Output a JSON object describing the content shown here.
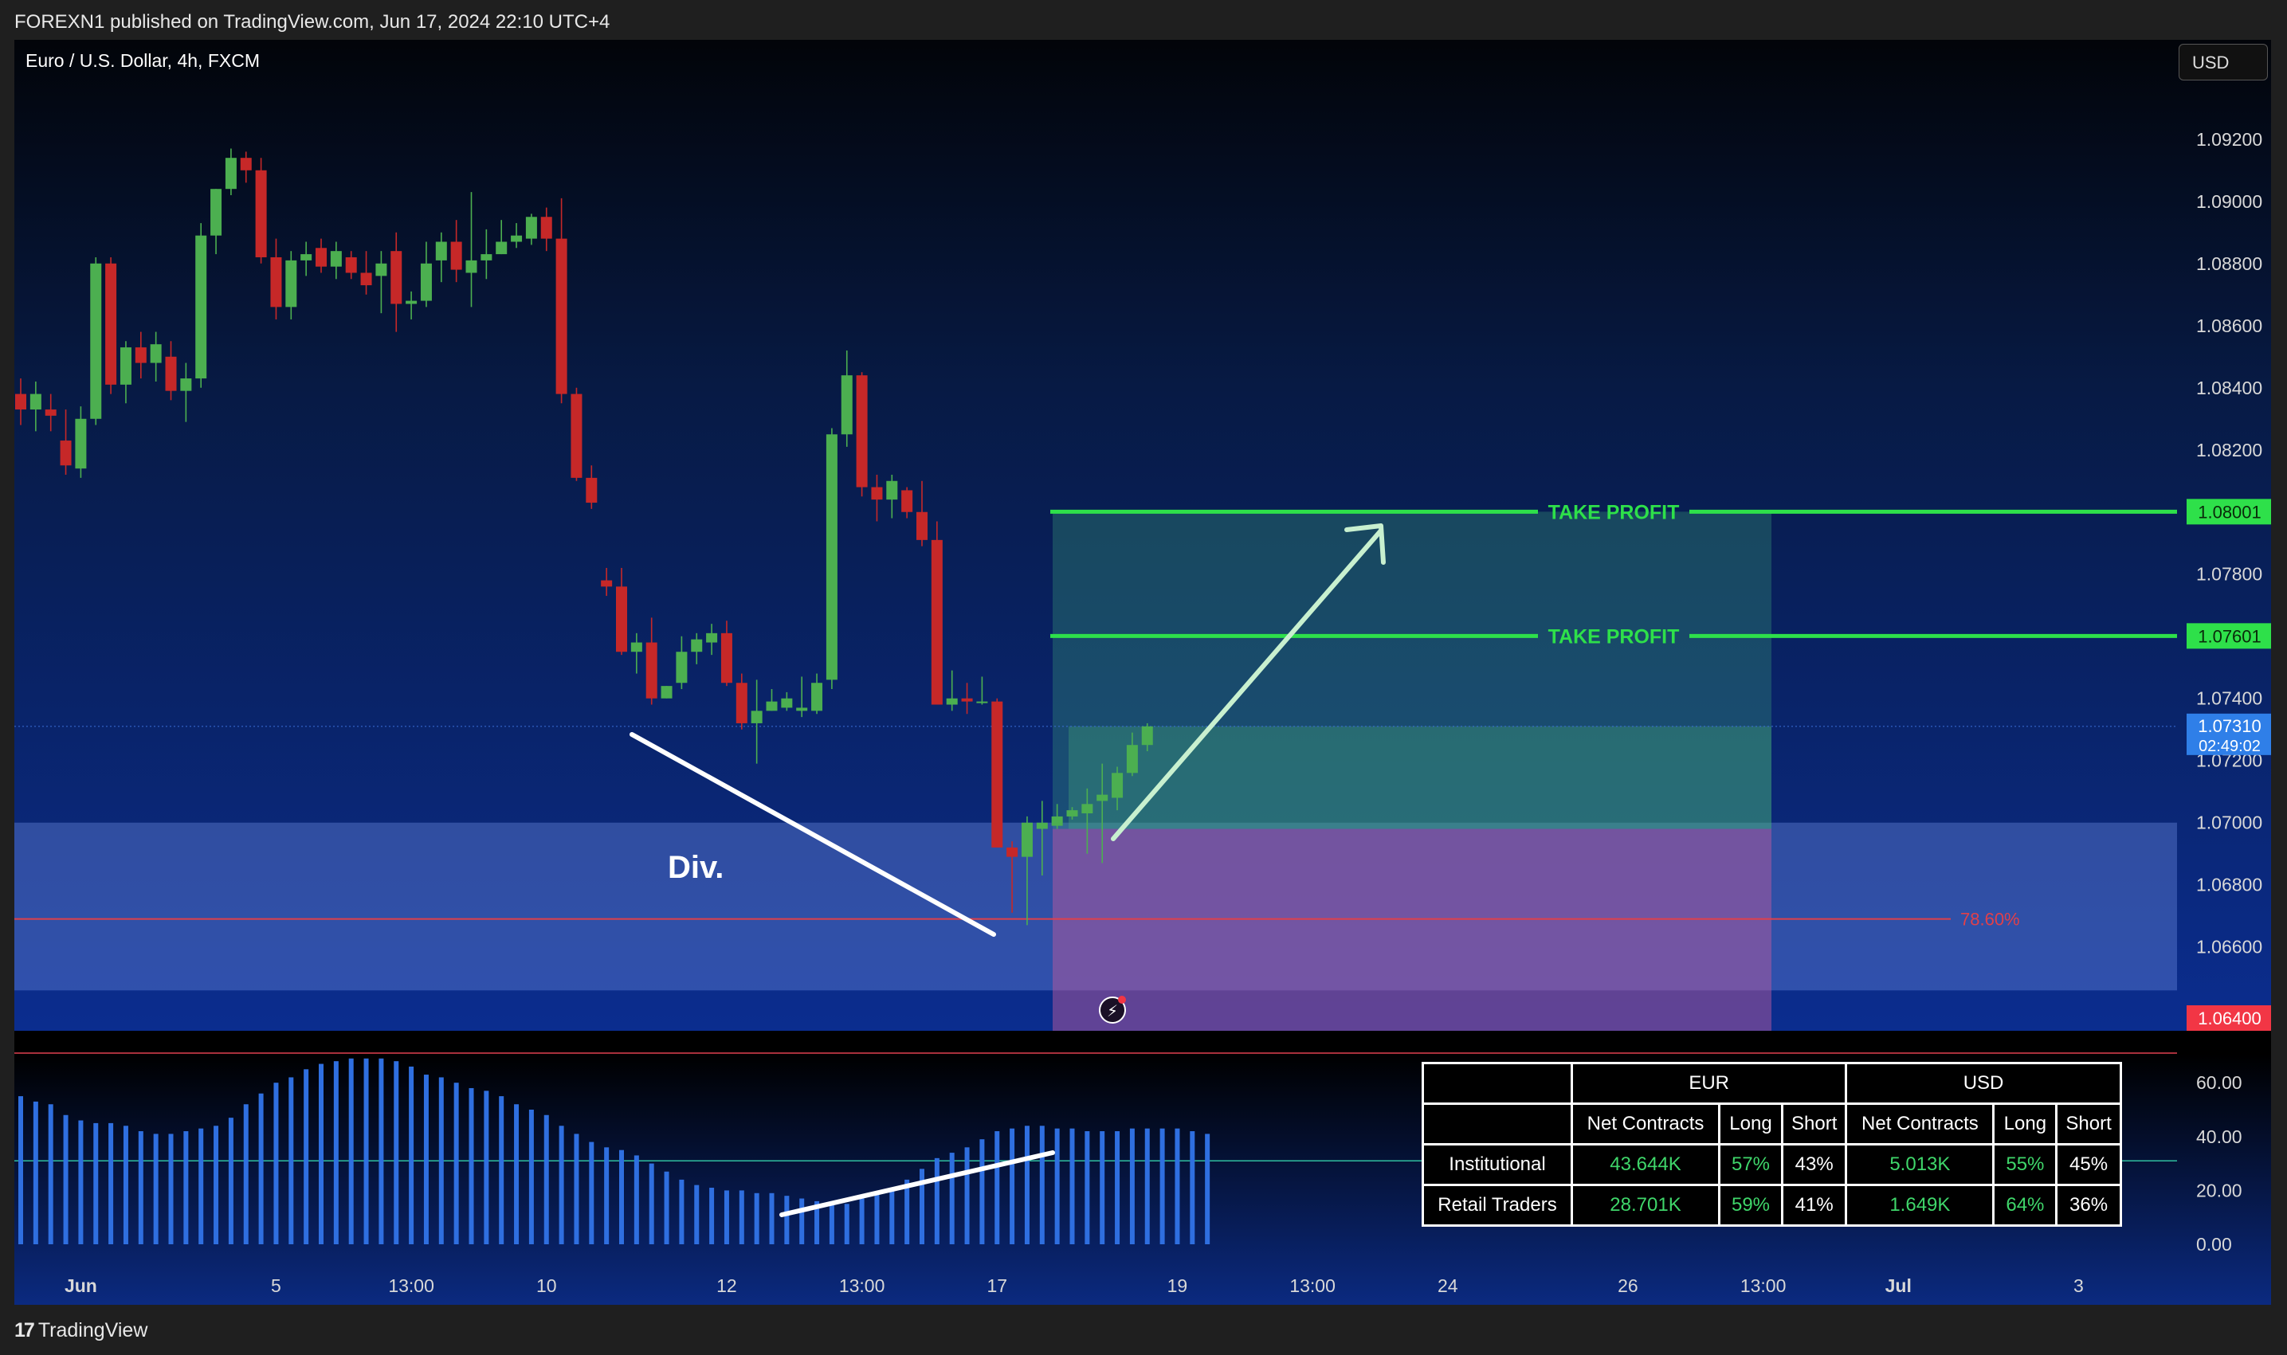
{
  "header": {
    "publish_line": "FOREXN1 published on TradingView.com, Jun 17, 2024 22:10 UTC+4"
  },
  "footer": {
    "brand": "TradingView"
  },
  "chart_data": {
    "type": "candlestick",
    "title": "Euro / U.S. Dollar, 4h, FXCM",
    "currency": "USD",
    "price_axis": {
      "ticks": [
        1.092,
        1.09,
        1.088,
        1.086,
        1.084,
        1.082,
        1.078,
        1.074,
        1.072,
        1.07,
        1.068,
        1.066
      ],
      "tick_labels": [
        "1.09200",
        "1.09000",
        "1.08800",
        "1.08600",
        "1.08400",
        "1.08200",
        "1.07800",
        "1.07400",
        "1.07200",
        "1.07000",
        "1.06800",
        "1.06600"
      ],
      "range": [
        1.0633,
        1.0952
      ]
    },
    "time_axis": {
      "labels": [
        "Jun",
        "5",
        "13:00",
        "10",
        "12",
        "13:00",
        "17",
        "19",
        "13:00",
        "24",
        "26",
        "13:00",
        "Jul",
        "3"
      ],
      "label_bar_index": [
        4,
        17,
        26,
        35,
        47,
        56,
        65,
        77,
        86,
        95,
        107,
        116,
        125,
        137
      ]
    },
    "candles": [
      [
        1.0838,
        1.0843,
        1.0828,
        1.0833
      ],
      [
        1.0833,
        1.0842,
        1.0826,
        1.0838
      ],
      [
        1.0833,
        1.0838,
        1.0826,
        1.0831
      ],
      [
        1.0823,
        1.0833,
        1.0812,
        1.0815
      ],
      [
        1.0814,
        1.0834,
        1.0811,
        1.083
      ],
      [
        1.083,
        1.0882,
        1.0828,
        1.088
      ],
      [
        1.088,
        1.0882,
        1.0838,
        1.0841
      ],
      [
        1.0841,
        1.0855,
        1.0835,
        1.0853
      ],
      [
        1.0853,
        1.0858,
        1.0843,
        1.0848
      ],
      [
        1.0848,
        1.0858,
        1.0842,
        1.0854
      ],
      [
        1.085,
        1.0855,
        1.0836,
        1.0839
      ],
      [
        1.0839,
        1.0848,
        1.0829,
        1.0843
      ],
      [
        1.0843,
        1.0893,
        1.084,
        1.0889
      ],
      [
        1.0889,
        1.0904,
        1.0883,
        1.0904
      ],
      [
        1.0904,
        1.0917,
        1.0902,
        1.0914
      ],
      [
        1.0914,
        1.0916,
        1.0906,
        1.091
      ],
      [
        1.091,
        1.0914,
        1.088,
        1.0882
      ],
      [
        1.0882,
        1.0888,
        1.0862,
        1.0866
      ],
      [
        1.0866,
        1.0884,
        1.0862,
        1.0881
      ],
      [
        1.0881,
        1.0887,
        1.0876,
        1.0883
      ],
      [
        1.0885,
        1.0888,
        1.0877,
        1.0879
      ],
      [
        1.0879,
        1.0887,
        1.0875,
        1.0884
      ],
      [
        1.0882,
        1.0884,
        1.0875,
        1.0877
      ],
      [
        1.0877,
        1.0884,
        1.087,
        1.0873
      ],
      [
        1.0876,
        1.0884,
        1.0864,
        1.088
      ],
      [
        1.0884,
        1.089,
        1.0858,
        1.0867
      ],
      [
        1.0867,
        1.0871,
        1.0862,
        1.0868
      ],
      [
        1.0868,
        1.0887,
        1.0866,
        1.088
      ],
      [
        1.0881,
        1.089,
        1.0874,
        1.0887
      ],
      [
        1.0887,
        1.0894,
        1.0874,
        1.0878
      ],
      [
        1.0877,
        1.0903,
        1.0866,
        1.0881
      ],
      [
        1.0881,
        1.0891,
        1.0875,
        1.0883
      ],
      [
        1.0883,
        1.0894,
        1.0883,
        1.0887
      ],
      [
        1.0887,
        1.0893,
        1.0885,
        1.0889
      ],
      [
        1.0888,
        1.0896,
        1.0886,
        1.0895
      ],
      [
        1.0895,
        1.0898,
        1.0884,
        1.0888
      ],
      [
        1.0888,
        1.0901,
        1.0835,
        1.0838
      ],
      [
        1.0838,
        1.084,
        1.081,
        1.0811
      ],
      [
        1.0811,
        1.0815,
        1.0801,
        1.0803
      ],
      [
        1.0778,
        1.0782,
        1.0773,
        1.0776
      ],
      [
        1.0776,
        1.0782,
        1.0754,
        1.0755
      ],
      [
        1.0755,
        1.0761,
        1.0748,
        1.0758
      ],
      [
        1.0758,
        1.0766,
        1.0738,
        1.074
      ],
      [
        1.074,
        1.0744,
        1.074,
        1.0744
      ],
      [
        1.0745,
        1.076,
        1.0743,
        1.0755
      ],
      [
        1.0755,
        1.0761,
        1.0751,
        1.0759
      ],
      [
        1.0758,
        1.0764,
        1.0754,
        1.0761
      ],
      [
        1.0761,
        1.0765,
        1.0744,
        1.0745
      ],
      [
        1.0745,
        1.0748,
        1.073,
        1.0732
      ],
      [
        1.0732,
        1.0746,
        1.0719,
        1.0736
      ],
      [
        1.0736,
        1.0743,
        1.0736,
        1.0739
      ],
      [
        1.0737,
        1.0742,
        1.0736,
        1.074
      ],
      [
        1.0736,
        1.0747,
        1.0734,
        1.0737
      ],
      [
        1.0736,
        1.0748,
        1.0735,
        1.0745
      ],
      [
        1.0746,
        1.0827,
        1.0743,
        1.0825
      ],
      [
        1.0825,
        1.0852,
        1.0821,
        1.0844
      ],
      [
        1.0844,
        1.0845,
        1.0805,
        1.0808
      ],
      [
        1.0808,
        1.0812,
        1.0797,
        1.0804
      ],
      [
        1.0804,
        1.0812,
        1.0798,
        1.081
      ],
      [
        1.0807,
        1.0808,
        1.0798,
        1.08
      ],
      [
        1.08,
        1.081,
        1.0789,
        1.0791
      ],
      [
        1.0791,
        1.0797,
        1.0738,
        1.0738
      ],
      [
        1.0738,
        1.0749,
        1.0736,
        1.074
      ],
      [
        1.074,
        1.0745,
        1.0735,
        1.0739
      ],
      [
        1.0739,
        1.0747,
        1.0738,
        1.0739
      ],
      [
        1.0739,
        1.074,
        1.0699,
        1.0692
      ],
      [
        1.0692,
        1.0694,
        1.0671,
        1.0689
      ],
      [
        1.0689,
        1.0702,
        1.0667,
        1.07
      ],
      [
        1.0698,
        1.0707,
        1.0683,
        1.07
      ],
      [
        1.0699,
        1.0706,
        1.0698,
        1.0702
      ],
      [
        1.0702,
        1.0705,
        1.0701,
        1.0704
      ],
      [
        1.0703,
        1.0711,
        1.069,
        1.0706
      ],
      [
        1.0707,
        1.0719,
        1.0687,
        1.0709
      ],
      [
        1.0708,
        1.0718,
        1.0704,
        1.0716
      ],
      [
        1.0716,
        1.0729,
        1.0715,
        1.0725
      ],
      [
        1.0725,
        1.0732,
        1.0723,
        1.0731
      ]
    ],
    "annotations": {
      "take_profit_labels": [
        "TAKE PROFIT",
        "TAKE PROFIT"
      ],
      "take_profit_1": 1.08001,
      "take_profit_2": 1.07601,
      "take_profit_1_label": "1.08001",
      "take_profit_2_label": "1.07601",
      "current_price": 1.0731,
      "current_price_label": "1.07310",
      "countdown": "02:49:02",
      "stop_label": "1.06400",
      "stop_price": 1.064,
      "entry_price": 1.0698,
      "fib_level": 1.0669,
      "fib_label": "78.60%",
      "zone": [
        1.0646,
        1.07
      ],
      "divergence_label": "Div."
    },
    "oscillator": {
      "ticks": [
        60,
        40,
        20,
        0
      ],
      "tick_labels": [
        "60.00",
        "40.00",
        "20.00",
        "0.00"
      ],
      "mid_line": 31,
      "upper_line": 71,
      "values": [
        55,
        53,
        52,
        48,
        46,
        45,
        45,
        44,
        42,
        41,
        41,
        42,
        43,
        44,
        47,
        52,
        56,
        60,
        62,
        65,
        67,
        68,
        69,
        69,
        69,
        68,
        66,
        63,
        62,
        60,
        58,
        57,
        55,
        52,
        50,
        48,
        44,
        41,
        38,
        36,
        35,
        33,
        30,
        27,
        24,
        22,
        21,
        20,
        20,
        19,
        19,
        18,
        17,
        16,
        15,
        15,
        17,
        19,
        21,
        24,
        28,
        32,
        34,
        36,
        39,
        42,
        43,
        44,
        44,
        43,
        43,
        42,
        42,
        42,
        43,
        43,
        43,
        43,
        42,
        41
      ]
    },
    "cot_table": {
      "groups": [
        "EUR",
        "USD"
      ],
      "columns": [
        "Net Contracts",
        "Long",
        "Short",
        "Net Contracts",
        "Long",
        "Short"
      ],
      "rows": [
        {
          "label": "Institutional",
          "cells": [
            "43.644K",
            "57%",
            "43%",
            "5.013K",
            "55%",
            "45%"
          ]
        },
        {
          "label": "Retail Traders",
          "cells": [
            "28.701K",
            "59%",
            "41%",
            "1.649K",
            "64%",
            "36%"
          ]
        }
      ]
    },
    "colors": {
      "up": "#4caf50",
      "down": "#c62828",
      "take_profit": "#2ee04a",
      "fib": "#e0404a",
      "stop_bg": "#f23645",
      "current_price_bg": "#2f7fe8",
      "oscillator": "#2f6fe0"
    }
  }
}
